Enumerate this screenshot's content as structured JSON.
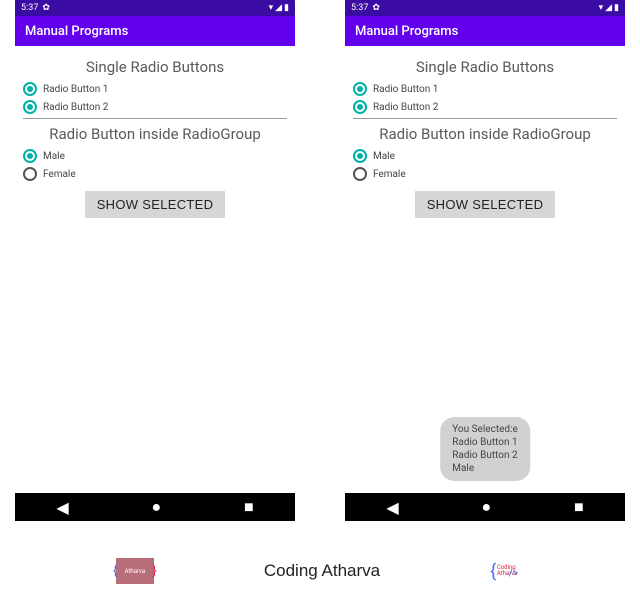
{
  "status": {
    "time": "5:37",
    "gear": "✿"
  },
  "appbar": {
    "title": "Manual Programs"
  },
  "section1": {
    "heading": "Single Radio Buttons",
    "r1": "Radio Button 1",
    "r2": "Radio Button 2"
  },
  "section2": {
    "heading": "Radio Button inside RadioGroup",
    "r1": "Male",
    "r2": "Female"
  },
  "button": {
    "label": "SHOW SELECTED"
  },
  "toast": {
    "l1": "You Selected:e",
    "l2": "Radio Button 1",
    "l3": "Radio Button 2",
    "l4": "Male"
  },
  "footer": {
    "brand": "Coding Atharva"
  }
}
